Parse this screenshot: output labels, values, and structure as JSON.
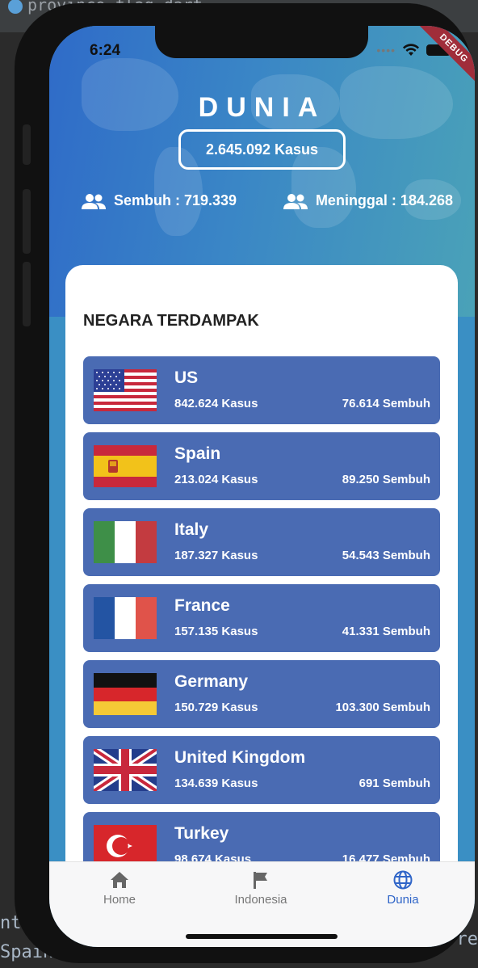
{
  "ide": {
    "tab_text": "province_flag.dart",
    "code_line_1": "nt'",
    "code_line_2": "Spain',",
    "code_right": "re"
  },
  "status_bar": {
    "time": "6:24",
    "debug_label": "DEBUG"
  },
  "header": {
    "title": "DUNIA",
    "total_cases": "2.645.092 Kasus",
    "recovered": "Sembuh : 719.339",
    "deaths": "Meninggal : 184.268"
  },
  "section": {
    "title": "NEGARA TERDAMPAK"
  },
  "countries": [
    {
      "name": "US",
      "cases": "842.624 Kasus",
      "recovered": "76.614 Sembuh",
      "flag": "us-flag"
    },
    {
      "name": "Spain",
      "cases": "213.024 Kasus",
      "recovered": "89.250 Sembuh",
      "flag": "spain-flag"
    },
    {
      "name": "Italy",
      "cases": "187.327 Kasus",
      "recovered": "54.543 Sembuh",
      "flag": "italy-flag"
    },
    {
      "name": "France",
      "cases": "157.135 Kasus",
      "recovered": "41.331 Sembuh",
      "flag": "france-flag"
    },
    {
      "name": "Germany",
      "cases": "150.729 Kasus",
      "recovered": "103.300 Sembuh",
      "flag": "germany-flag"
    },
    {
      "name": "United Kingdom",
      "cases": "134.639 Kasus",
      "recovered": "691 Sembuh",
      "flag": "uk-flag"
    },
    {
      "name": "Turkey",
      "cases": "98.674 Kasus",
      "recovered": "16.477 Sembuh",
      "flag": "turkey-flag"
    }
  ],
  "nav": {
    "items": [
      {
        "label": "Home",
        "icon": "home-icon",
        "active": false
      },
      {
        "label": "Indonesia",
        "icon": "flag-icon",
        "active": false
      },
      {
        "label": "Dunia",
        "icon": "globe-icon",
        "active": true
      }
    ]
  },
  "colors": {
    "header_start": "#2f6bc8",
    "header_end": "#4aa2b8",
    "card_row": "#4a6bb3",
    "active_nav": "#2f65c8"
  }
}
